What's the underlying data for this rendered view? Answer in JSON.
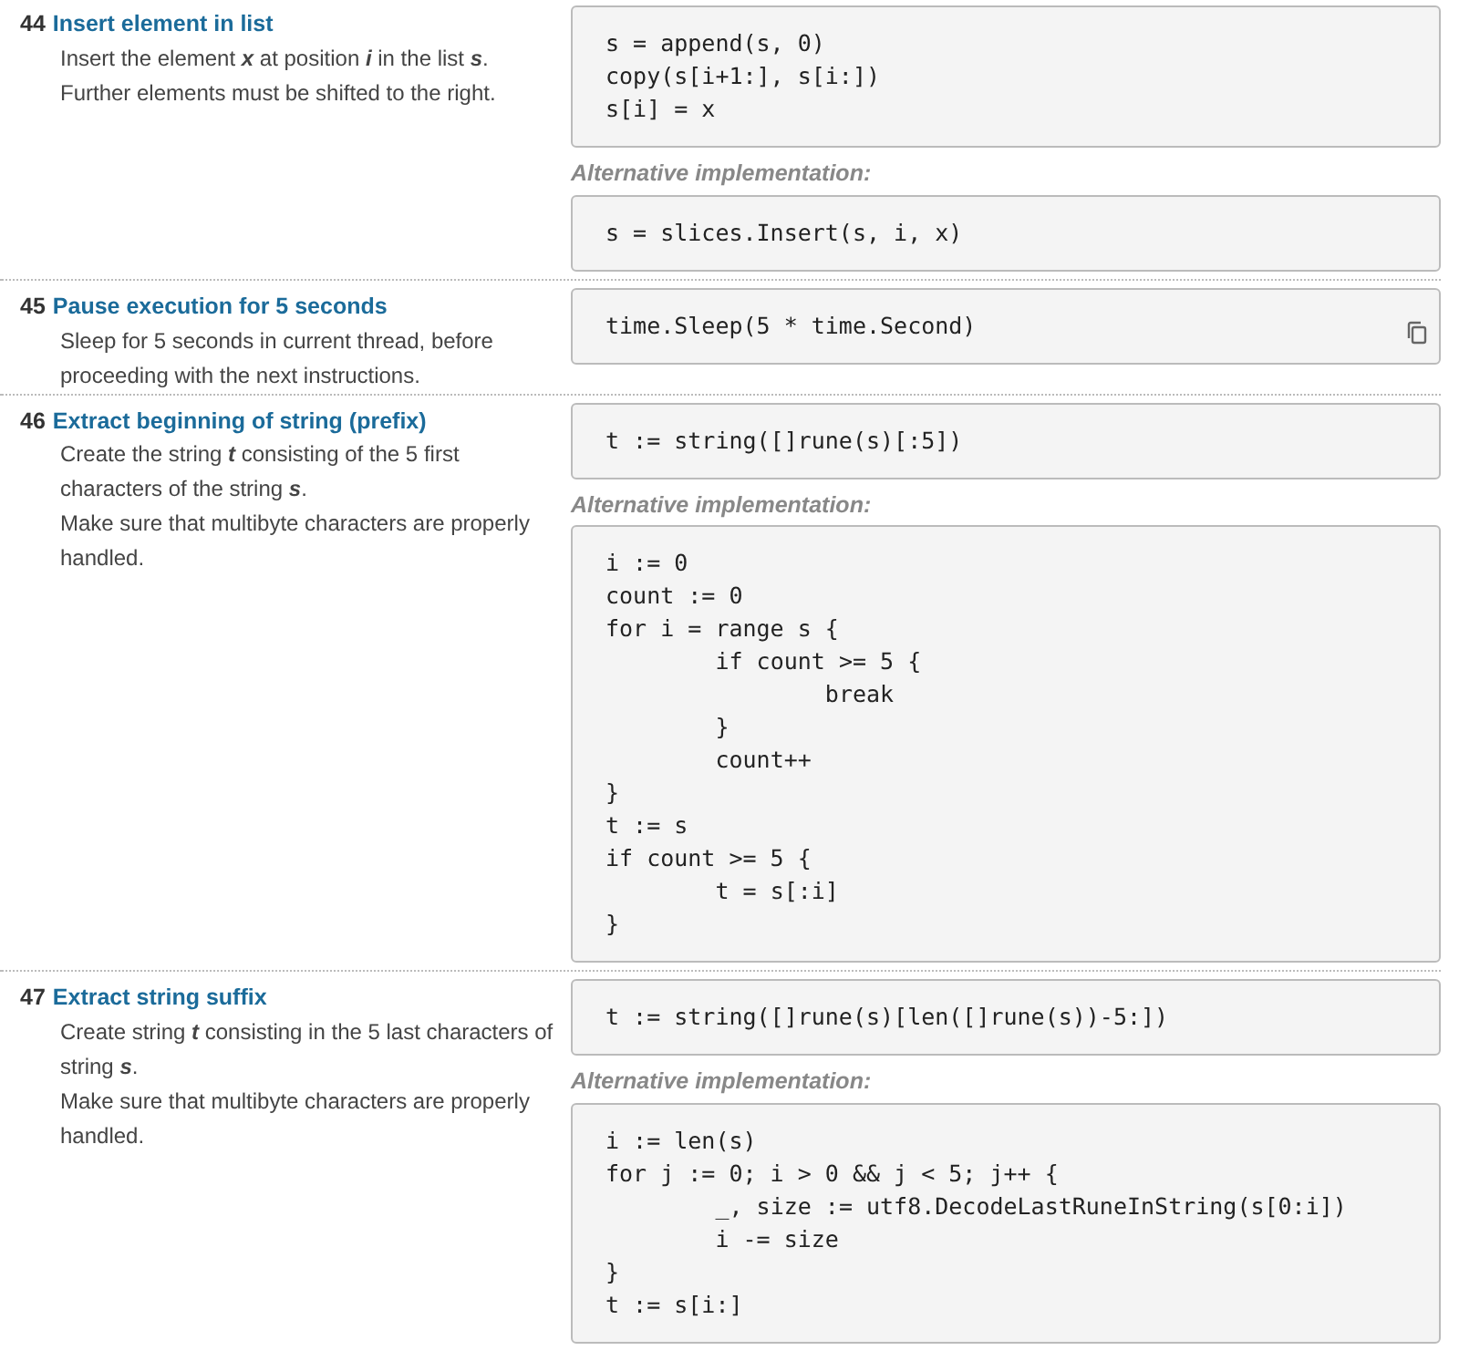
{
  "entries": [
    {
      "number": "44",
      "title": "Insert element in list",
      "description": [
        "Insert the element **x** at position **i** in the list **s**.",
        "Further elements must be shifted to the right."
      ],
      "blocks": [
        {
          "code": "s = append(s, 0)\ncopy(s[i+1:], s[i:])\ns[i] = x",
          "copy_icon": false
        },
        {
          "label": "Alternative implementation:",
          "code": "s = slices.Insert(s, i, x)",
          "copy_icon": false
        }
      ]
    },
    {
      "number": "45",
      "title": "Pause execution for 5 seconds",
      "description": [
        "Sleep for 5 seconds in current thread, before proceeding with the next instructions."
      ],
      "blocks": [
        {
          "code": "time.Sleep(5 * time.Second)",
          "copy_icon": true
        }
      ]
    },
    {
      "number": "46",
      "title": "Extract beginning of string (prefix)",
      "description": [
        "Create the string **t** consisting of the 5 first characters of the string **s**.",
        "Make sure that multibyte characters are properly handled."
      ],
      "blocks": [
        {
          "code": "t := string([]rune(s)[:5])",
          "copy_icon": false
        },
        {
          "label": "Alternative implementation:",
          "code": "i := 0\ncount := 0\nfor i = range s {\n\tif count >= 5 {\n\t\tbreak\n\t}\n\tcount++\n}\nt := s\nif count >= 5 {\n\tt = s[:i]\n}",
          "copy_icon": false
        }
      ]
    },
    {
      "number": "47",
      "title": "Extract string suffix",
      "description": [
        "Create string **t** consisting in the 5 last characters of string **s**.",
        "Make sure that multibyte characters are properly handled."
      ],
      "blocks": [
        {
          "code": "t := string([]rune(s)[len([]rune(s))-5:])",
          "copy_icon": false
        },
        {
          "label": "Alternative implementation:",
          "code": "i := len(s)\nfor j := 0; i > 0 && j < 5; j++ {\n\t_, size := utf8.DecodeLastRuneInString(s[0:i])\n\ti -= size\n}\nt := s[i:]",
          "copy_icon": false
        }
      ]
    }
  ]
}
